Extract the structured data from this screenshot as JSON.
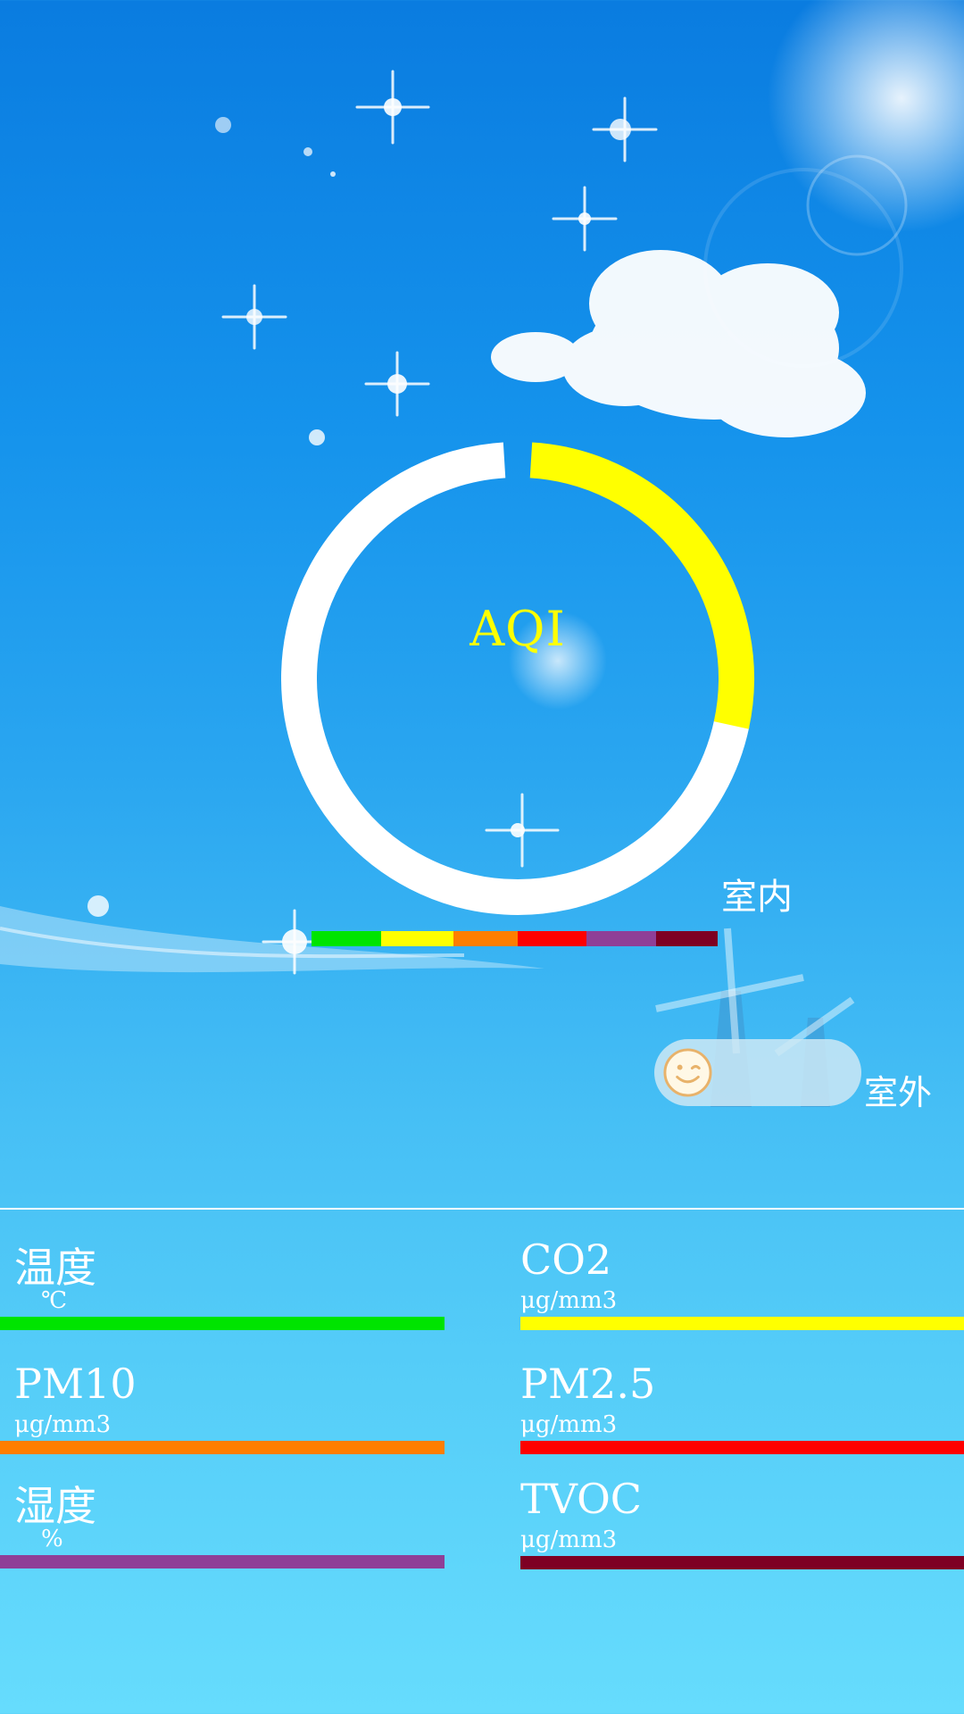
{
  "aqi": {
    "label": "AQI",
    "ring_fill_fraction": 0.28,
    "ring_color": "#ffffff",
    "fill_color": "#ffff00"
  },
  "scale_colors": [
    "#00e400",
    "#ffff00",
    "#ff7e00",
    "#ff0000",
    "#8f3f97",
    "#7e0023"
  ],
  "tabs": {
    "indoor": "室内",
    "outdoor": "室外"
  },
  "toggle": {
    "knob_icon": "smiley-wink-icon",
    "state": "indoor"
  },
  "metrics": {
    "temperature": {
      "name": "温度",
      "unit": "℃",
      "color": "#00e400"
    },
    "co2": {
      "name": "CO2",
      "unit": "μg/mm3",
      "color": "#ffff00"
    },
    "pm10": {
      "name": "PM10",
      "unit": "μg/mm3",
      "color": "#ff7e00"
    },
    "pm25": {
      "name": "PM2.5",
      "unit": "μg/mm3",
      "color": "#ff0000"
    },
    "humidity": {
      "name": "湿度",
      "unit": "%",
      "color": "#8f3f97"
    },
    "tvoc": {
      "name": "TVOC",
      "unit": "μg/mm3",
      "color": "#7e0023"
    }
  }
}
